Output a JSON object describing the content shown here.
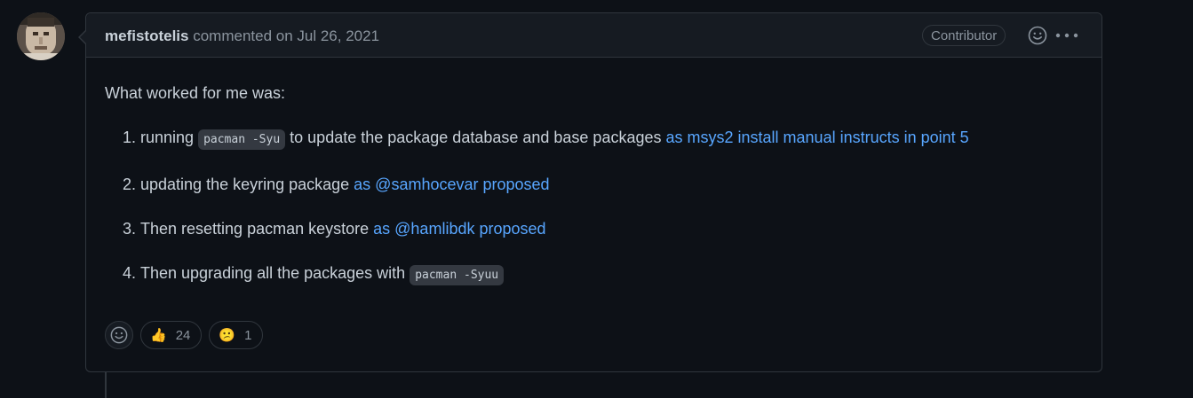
{
  "comment": {
    "author": "mefistotelis",
    "action_text": "commented on Jul 26, 2021",
    "badge": "Contributor",
    "body": {
      "intro": "What worked for me was:",
      "steps": [
        {
          "before": "running ",
          "code": "pacman -Syu",
          "after": " to update the package database and base packages ",
          "link": "as msys2 install manual instructs in point 5"
        },
        {
          "before": "updating the keyring package ",
          "link": "as @samhocevar proposed"
        },
        {
          "before": "Then resetting pacman keystore ",
          "link": "as @hamlibdk proposed"
        },
        {
          "before": "Then upgrading all the packages with ",
          "code": "pacman -Syuu"
        }
      ]
    },
    "reactions": [
      {
        "icon": "thumbs-up-icon",
        "emoji": "👍",
        "count": "24"
      },
      {
        "icon": "confused-face-icon",
        "emoji": "😕",
        "count": "1"
      }
    ]
  },
  "colors": {
    "background": "#0d1117",
    "header_bg": "#161b22",
    "border": "#30363d",
    "link": "#58a6ff",
    "text": "#c9d1d9",
    "muted": "#8b949e"
  }
}
